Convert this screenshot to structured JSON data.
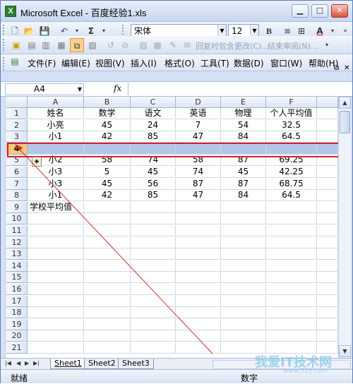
{
  "window": {
    "title": "Microsoft Excel - 百度经验1.xls",
    "min": "▁",
    "max": "□",
    "close": "✕"
  },
  "toolbar": {
    "font": "宋体",
    "size": "12",
    "bold": "B",
    "sum": "Σ",
    "fontcolor": "A"
  },
  "reviewbar": {
    "reply": "回复时包含更改(C)...",
    "end": "结束审阅(N)..."
  },
  "menu": [
    "文件(F)",
    "编辑(E)",
    "视图(V)",
    "插入(I)",
    "格式(O)",
    "工具(T)",
    "数据(D)",
    "窗口(W)",
    "帮助(H)"
  ],
  "namebox": "A4",
  "fx": "fx",
  "columns": [
    "A",
    "B",
    "C",
    "D",
    "E",
    "F"
  ],
  "rows": [
    "1",
    "2",
    "3",
    "4",
    "5",
    "6",
    "7",
    "8",
    "9",
    "10",
    "11",
    "12",
    "13",
    "14",
    "15",
    "16",
    "17",
    "18",
    "19",
    "20",
    "21"
  ],
  "cells": [
    [
      "姓名",
      "数学",
      "语文",
      "英语",
      "物理",
      "个人平均值"
    ],
    [
      "小亮",
      "45",
      "24",
      "7",
      "54",
      "32.5"
    ],
    [
      "小1",
      "42",
      "85",
      "47",
      "84",
      "64.5"
    ],
    [
      "",
      "",
      "",
      "",
      "",
      ""
    ],
    [
      "小2",
      "58",
      "74",
      "58",
      "87",
      "69.25"
    ],
    [
      "小3",
      "5",
      "45",
      "74",
      "45",
      "42.25"
    ],
    [
      "小3",
      "45",
      "56",
      "87",
      "87",
      "68.75"
    ],
    [
      "小1",
      "42",
      "85",
      "47",
      "84",
      "64.5"
    ],
    [
      "学校平均值",
      "",
      "",
      "",
      "",
      ""
    ]
  ],
  "sheets": [
    "Sheet1",
    "Sheet2",
    "Sheet3"
  ],
  "status": {
    "left": "就绪",
    "mid": "数字"
  },
  "watermark": {
    "big": "我爱IT技术网",
    "small": "www.52ij.com"
  },
  "colors": {
    "selected_row": "#b4c7e7",
    "highlight_box": "#d21f2f",
    "selected_header": "#f9c77a"
  }
}
